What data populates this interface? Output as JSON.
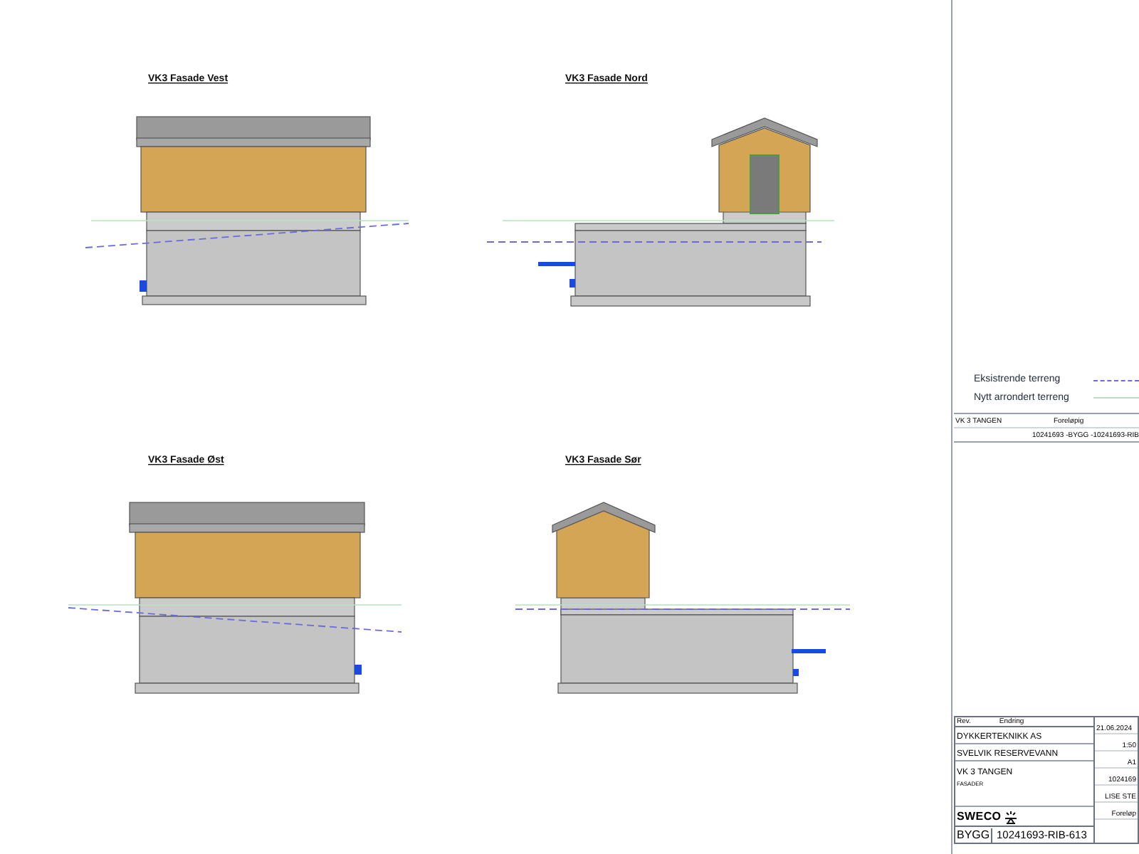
{
  "views": [
    {
      "title": "VK3 Fasade Vest",
      "kind": "west"
    },
    {
      "title": "VK3 Fasade Nord",
      "kind": "north"
    },
    {
      "title": "VK3 Fasade Øst",
      "kind": "east"
    },
    {
      "title": "VK3 Fasade Sør",
      "kind": "south"
    }
  ],
  "legend": [
    {
      "label": "Eksistrende terreng",
      "kind": "dashed",
      "color": "#6a6ad8"
    },
    {
      "label": "Nytt arrondert  terreng",
      "kind": "solid",
      "color": "#b8e0c0"
    }
  ],
  "sheet_info": {
    "drawing_name": "VK 3 TANGEN",
    "status": "Foreløpig",
    "file_name": "10241693 -BYGG -10241693-RIB"
  },
  "title_block": {
    "revision_label": "Rev.",
    "change_label": "Endring",
    "client": "DYKKERTEKNIKK AS",
    "project": "SVELVIK RESERVEVANN",
    "location": "VK 3 TANGEN",
    "subject": "FASADER",
    "company": "SWECO",
    "discipline": "BYGG",
    "drawing_number": "10241693-RIB-613",
    "date": "21.06.2024",
    "scale": "1:50",
    "format": "A1",
    "project_number": "1024169",
    "designer": "LISE STE",
    "status": "Foreløp"
  }
}
